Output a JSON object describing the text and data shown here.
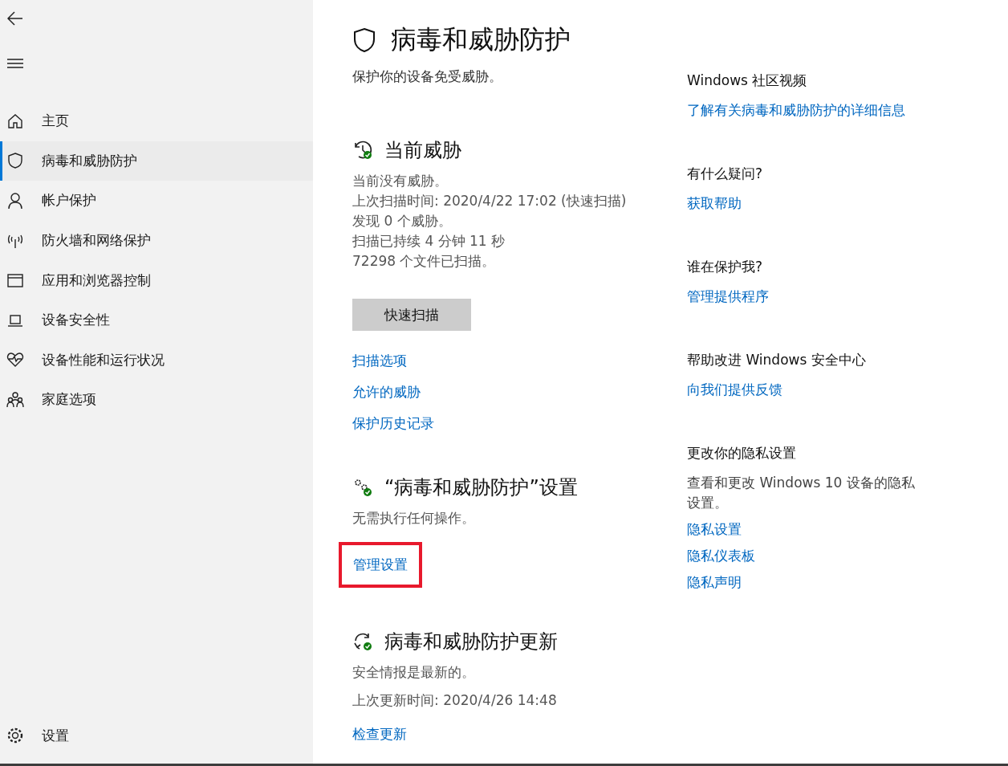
{
  "sidebar": {
    "items": [
      {
        "label": "主页",
        "selected": false
      },
      {
        "label": "病毒和威胁防护",
        "selected": true
      },
      {
        "label": "帐户保护",
        "selected": false
      },
      {
        "label": "防火墙和网络保护",
        "selected": false
      },
      {
        "label": "应用和浏览器控制",
        "selected": false
      },
      {
        "label": "设备安全性",
        "selected": false
      },
      {
        "label": "设备性能和运行状况",
        "selected": false
      },
      {
        "label": "家庭选项",
        "selected": false
      }
    ],
    "footer": {
      "label": "设置"
    }
  },
  "main": {
    "title": "病毒和威胁防护",
    "subtitle": "保护你的设备免受威胁。",
    "sections": [
      {
        "kind": "threats",
        "heading": "当前威胁",
        "lines": [
          "当前没有威胁。",
          "上次扫描时间: 2020/4/22 17:02 (快速扫描)",
          "发现 0 个威胁。",
          "扫描已持续 4 分钟 11 秒",
          "72298 个文件已扫描。"
        ],
        "button": "快速扫描",
        "links": [
          {
            "label": "扫描选项",
            "highlighted": false
          },
          {
            "label": "允许的威胁",
            "highlighted": false
          },
          {
            "label": "保护历史记录",
            "highlighted": false
          }
        ]
      },
      {
        "kind": "settings",
        "heading": "“病毒和威胁防护”设置",
        "lines": [
          "无需执行任何操作。"
        ],
        "links": [
          {
            "label": "管理设置",
            "highlighted": true
          }
        ]
      },
      {
        "kind": "updates",
        "heading": "病毒和威胁防护更新",
        "lines": [
          "安全情报是最新的。",
          "上次更新时间: 2020/4/26 14:48"
        ],
        "links": [
          {
            "label": "检查更新",
            "highlighted": false
          }
        ]
      }
    ]
  },
  "aside": {
    "groups": [
      {
        "heading": "Windows 社区视频",
        "links": [
          "了解有关病毒和威胁防护的详细信息"
        ]
      },
      {
        "heading": "有什么疑问?",
        "links": [
          "获取帮助"
        ]
      },
      {
        "heading": "谁在保护我?",
        "links": [
          "管理提供程序"
        ]
      },
      {
        "heading": "帮助改进 Windows 安全中心",
        "links": [
          "向我们提供反馈"
        ]
      },
      {
        "heading": "更改你的隐私设置",
        "description": "查看和更改 Windows 10 设备的隐私设置。",
        "links": [
          "隐私设置",
          "隐私仪表板",
          "隐私声明"
        ]
      }
    ]
  }
}
